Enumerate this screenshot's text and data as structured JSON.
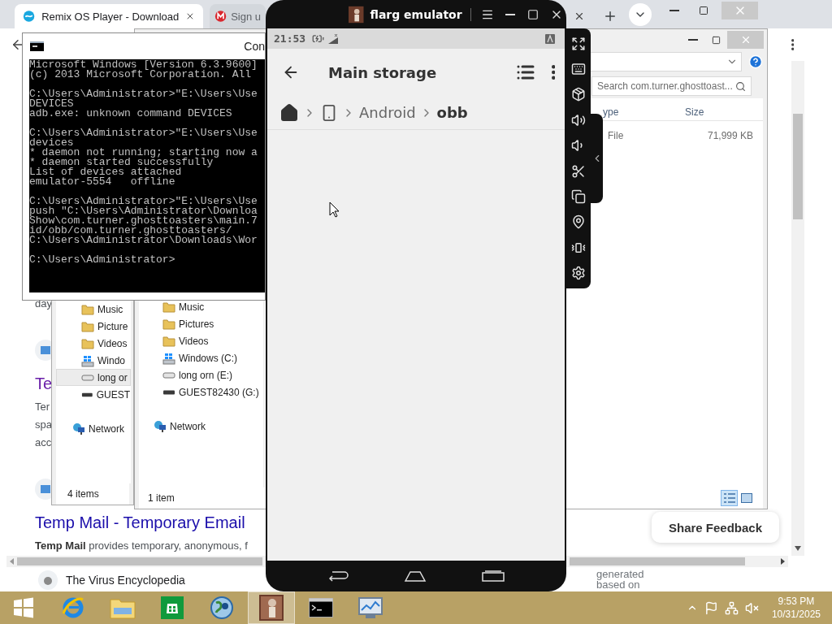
{
  "browser": {
    "tabs": [
      {
        "title": "Remix OS Player - Download",
        "selected": true,
        "kind": "remix"
      },
      {
        "title": "Sign u",
        "selected": false,
        "kind": "mega"
      }
    ],
    "results": [
      {
        "kind": "snippet",
        "lines": [
          "day"
        ]
      },
      {
        "kind": "icon"
      },
      {
        "kind": "title",
        "text": "Te",
        "visited": true
      },
      {
        "kind": "snippet",
        "lines": [
          "Ter",
          "spa",
          "acc"
        ]
      },
      {
        "kind": "icon"
      },
      {
        "kind": "title",
        "text": "Temp Mail - Temporary Email",
        "visited": false
      },
      {
        "kind": "snippet",
        "lines": [
          "**Temp Mail** provides temporary, anonymous, f"
        ]
      }
    ],
    "bottom_result": "The Virus Encyclopedia",
    "side_text": [
      "generated",
      "based on"
    ],
    "feedback_button": "Share Feedback"
  },
  "cmd": {
    "title": "Con",
    "blocks": [
      [
        "Microsoft Windows [Version 6.3.9600]",
        "(c) 2013 Microsoft Corporation. All"
      ],
      [
        "C:\\Users\\Administrator>\"E:\\Users\\Use",
        "DEVICES",
        "adb.exe: unknown command DEVICES"
      ],
      [
        "C:\\Users\\Administrator>\"E:\\Users\\Use",
        "devices",
        "* daemon not running; starting now a",
        "* daemon started successfully",
        "List of devices attached",
        "emulator-5554   offline"
      ],
      [
        "C:\\Users\\Administrator>\"E:\\Users\\Use",
        "push \"C:\\Users\\Administrator\\Downloa",
        "Show\\com.turner.ghosttoasters\\main.7",
        "id/obb/com.turner.ghosttoasters/",
        "C:\\Users\\Administrator\\Downloads\\Wor"
      ],
      [
        "C:\\Users\\Administrator>"
      ]
    ]
  },
  "explorer_back": {
    "nav": [
      {
        "label": "Music",
        "kind": "folder",
        "selected": false
      },
      {
        "label": "Picture",
        "kind": "folder",
        "selected": false
      },
      {
        "label": "Videos",
        "kind": "folder",
        "selected": false
      },
      {
        "label": "Windo",
        "kind": "system-drive",
        "selected": false
      },
      {
        "label": "long or",
        "kind": "drive",
        "selected": true
      },
      {
        "label": "GUEST",
        "kind": "removable",
        "selected": false
      },
      {
        "label": "Network",
        "kind": "network",
        "selected": false
      }
    ],
    "status": "4 items"
  },
  "explorer": {
    "search_placeholder": "Search com.turner.ghosttoast...",
    "columns": [
      "ype",
      "Size"
    ],
    "rows": [
      {
        "type": "File",
        "size": "71,999 KB"
      }
    ],
    "nav": [
      {
        "label": "Music",
        "kind": "folder",
        "selected": false
      },
      {
        "label": "Pictures",
        "kind": "folder",
        "selected": false
      },
      {
        "label": "Videos",
        "kind": "folder",
        "selected": false
      },
      {
        "label": "Windows (C:)",
        "kind": "system-drive",
        "selected": false
      },
      {
        "label": "long orn (E:)",
        "kind": "drive",
        "selected": false
      },
      {
        "label": "GUEST82430 (G:)",
        "kind": "removable",
        "selected": false
      },
      {
        "label": "Network",
        "kind": "network",
        "selected": false
      }
    ],
    "status": "1 item",
    "views": [
      {
        "kind": "details",
        "selected": true
      },
      {
        "kind": "large-icons",
        "selected": false
      }
    ]
  },
  "emulator": {
    "title": "flarg emulator",
    "time": "21:53",
    "app_title": "Main storage",
    "breadcrumb": [
      {
        "kind": "home"
      },
      {
        "kind": "device"
      },
      {
        "kind": "folder",
        "label": "Android",
        "selected": false
      },
      {
        "kind": "folder",
        "label": "obb",
        "selected": true
      }
    ],
    "tools": [
      {
        "kind": "fullscreen"
      },
      {
        "kind": "keyboard"
      },
      {
        "kind": "apk"
      },
      {
        "kind": "volume-up"
      },
      {
        "kind": "volume-down"
      },
      {
        "kind": "screenshot"
      },
      {
        "kind": "multi"
      },
      {
        "kind": "location"
      },
      {
        "kind": "shake"
      },
      {
        "kind": "settings"
      }
    ]
  },
  "taskbar": {
    "apps": [
      {
        "kind": "start",
        "selected": false
      },
      {
        "kind": "ie",
        "selected": false
      },
      {
        "kind": "explorer",
        "selected": false
      },
      {
        "kind": "store",
        "selected": false
      },
      {
        "kind": "globe",
        "selected": false
      },
      {
        "kind": "emulator",
        "selected": true
      },
      {
        "kind": "cmd",
        "selected": false
      },
      {
        "kind": "monitor",
        "selected": false
      }
    ],
    "time": "9:53 PM",
    "date": "10/31/2025"
  }
}
